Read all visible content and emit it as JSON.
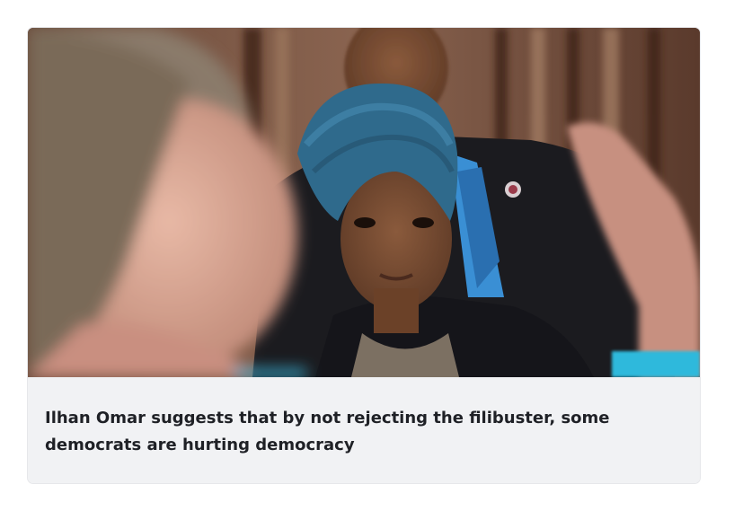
{
  "article_card": {
    "headline": "Ilhan Omar suggests that by not rejecting the filibuster, some democrats are hurting democracy",
    "image": {
      "icon": "news-photo"
    }
  }
}
